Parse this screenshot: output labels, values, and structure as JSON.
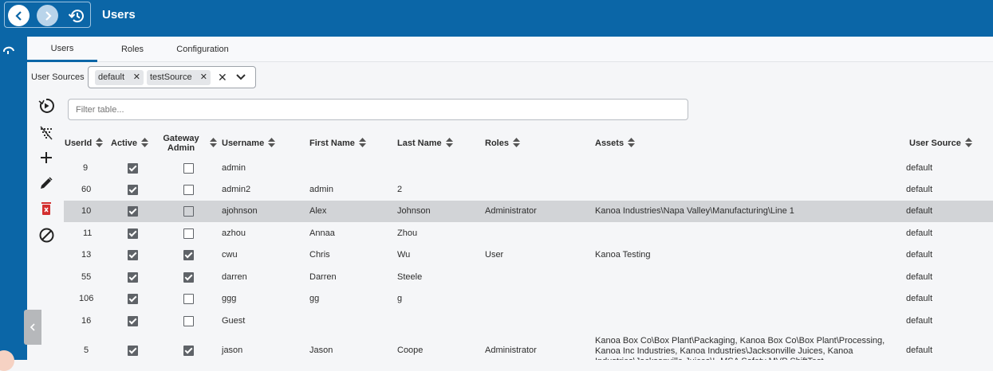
{
  "header": {
    "title": "Users"
  },
  "tabs": [
    "Users",
    "Roles",
    "Configuration"
  ],
  "user_sources": {
    "label": "User Sources",
    "chips": [
      "default",
      "testSource"
    ]
  },
  "filter": {
    "placeholder": "Filter table..."
  },
  "columns": {
    "userid": "UserId",
    "active": "Active",
    "gateway_admin_1": "Gateway",
    "gateway_admin_2": "Admin",
    "username": "Username",
    "first_name": "First Name",
    "last_name": "Last Name",
    "roles": "Roles",
    "assets": "Assets",
    "user_source": "User Source"
  },
  "rows": [
    {
      "id": "9",
      "active": true,
      "admin": false,
      "username": "admin",
      "first": "",
      "last": "",
      "roles": "",
      "assets": "",
      "source": "default"
    },
    {
      "id": "60",
      "active": true,
      "admin": false,
      "username": "admin2",
      "first": "admin",
      "last": "2",
      "roles": "",
      "assets": "",
      "source": "default"
    },
    {
      "id": "10",
      "active": true,
      "admin": false,
      "username": "ajohnson",
      "first": "Alex",
      "last": "Johnson",
      "roles": "Administrator",
      "assets": "Kanoa Industries\\Napa Valley\\Manufacturing\\Line 1",
      "source": "default",
      "selected": true
    },
    {
      "id": "11",
      "active": true,
      "admin": false,
      "username": "azhou",
      "first": "Annaa",
      "last": "Zhou",
      "roles": "",
      "assets": "",
      "source": "default"
    },
    {
      "id": "13",
      "active": true,
      "admin": true,
      "username": "cwu",
      "first": "Chris",
      "last": "Wu",
      "roles": "User",
      "assets": "Kanoa Testing",
      "source": "default"
    },
    {
      "id": "55",
      "active": true,
      "admin": true,
      "username": "darren",
      "first": "Darren",
      "last": "Steele",
      "roles": "",
      "assets": "",
      "source": "default"
    },
    {
      "id": "106",
      "active": true,
      "admin": false,
      "username": "ggg",
      "first": "gg",
      "last": "g",
      "roles": "",
      "assets": "",
      "source": "default"
    },
    {
      "id": "16",
      "active": true,
      "admin": false,
      "username": "Guest",
      "first": "",
      "last": "",
      "roles": "",
      "assets": "",
      "source": "default"
    },
    {
      "id": "5",
      "active": true,
      "admin": true,
      "username": "jason",
      "first": "Jason",
      "last": "Coope",
      "roles": "Administrator",
      "assets": "Kanoa Box Co\\Box Plant\\Packaging, Kanoa Box Co\\Box Plant\\Processing, Kanoa Inc Industries, Kanoa Industries\\Jacksonville Juices, Kanoa Industries\\Jacksonville Juices\\L-MSA Safety MVP ShiftTest",
      "source": "default"
    }
  ],
  "colors": {
    "brand": "#0b66a7",
    "selected_row": "#d2d4d7",
    "delete": "#d32f2f"
  },
  "icons": [
    "back-arrow-icon",
    "forward-arrow-icon",
    "history-icon",
    "refresh-play-icon",
    "clear-filter-icon",
    "add-icon",
    "edit-pencil-icon",
    "delete-icon",
    "disable-icon"
  ]
}
